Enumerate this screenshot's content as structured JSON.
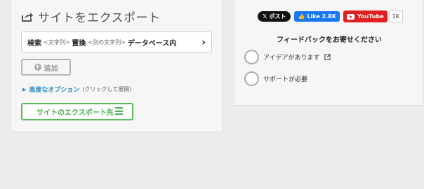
{
  "export": {
    "title": "サイトをエクスポート",
    "search": {
      "k1": "検索",
      "p1": "<文字列>",
      "k2": "置換",
      "p2": "<別の文字列>",
      "k3": "データベース内"
    },
    "add_label": "追加",
    "advanced_label": "高度なオプション",
    "advanced_hint": "(クリックして展開)",
    "export_button": "サイトのエクスポート先"
  },
  "social": {
    "x_label": "ポスト",
    "fb_label": "Like 2.8K",
    "yt_label": "YouTube",
    "yt_count": "1K"
  },
  "feedback": {
    "title": "フィードバックをお寄せください",
    "options": [
      "アイデアがあります",
      "サポートが必要"
    ]
  }
}
